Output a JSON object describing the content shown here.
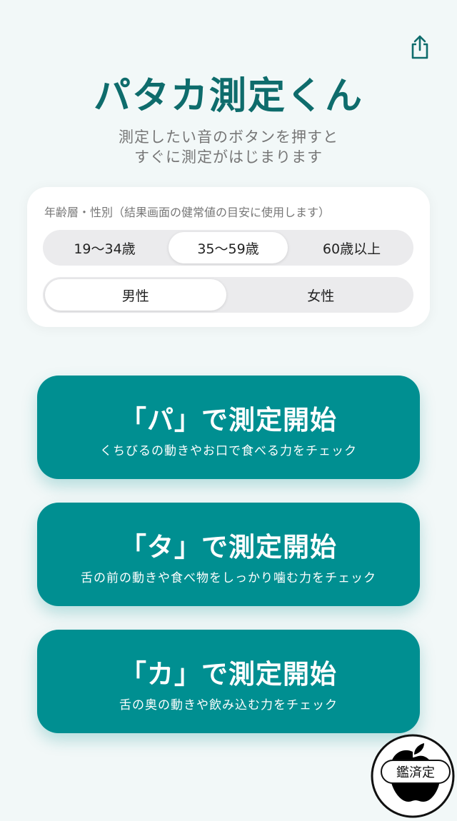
{
  "header": {
    "share_icon": "share-icon",
    "title": "パタカ測定くん",
    "subtitle_line1": "測定したい音のボタンを押すと",
    "subtitle_line2": "すぐに測定がはじまります"
  },
  "settings": {
    "label": "年齢層・性別（結果画面の健常値の目安に使用します）",
    "age_options": [
      "19〜34歳",
      "35〜59歳",
      "60歳以上"
    ],
    "age_selected": "35〜59歳",
    "sex_options": [
      "男性",
      "女性"
    ],
    "sex_selected": "男性"
  },
  "measure_buttons": [
    {
      "title": "「パ」で測定開始",
      "subtitle": "くちびるの動きやお口で食べる力をチェック"
    },
    {
      "title": "「タ」で測定開始",
      "subtitle": "舌の前の動きや食べ物をしっかり噛む力をチェック"
    },
    {
      "title": "「カ」で測定開始",
      "subtitle": "舌の奥の動きや飲み込む力をチェック"
    }
  ],
  "watermark": {
    "text": "鑑済定"
  },
  "colors": {
    "title": "#0e6c6c",
    "button": "#008f91",
    "background": "#f2f8f8"
  }
}
